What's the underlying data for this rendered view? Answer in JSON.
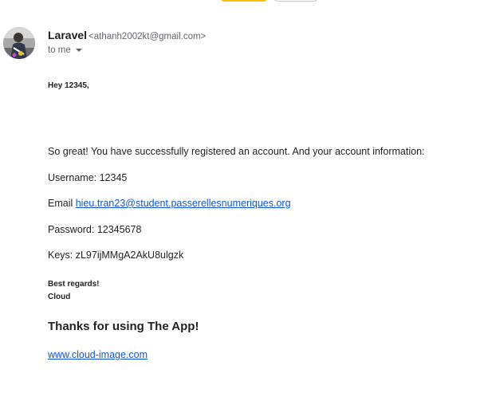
{
  "sender": {
    "name": "Laravel",
    "email": "<athanh2002kt@gmail.com>",
    "to_label": "to me"
  },
  "message": {
    "greeting": "Hey 12345,",
    "intro": "So great! You have successfully registered an account. And your account information:",
    "username_line": "Username: 12345",
    "email_label": "Email ",
    "email_value": "hieu.tran23@student.passerellesnumeriques.org",
    "password_line": "Password: 12345678",
    "keys_line": "Keys: zL97ijMMgA2AkU8ulgzk",
    "signoff": "Best regards!",
    "signature": "Cloud",
    "thanks": "Thanks for using The App!",
    "website_link": "www.cloud-image.com"
  },
  "colors": {
    "link": "#1155cc",
    "accent_chip": "#fbbc04"
  },
  "icons": {
    "avatar": "avatar-photo",
    "recipient_details": "caret-down-icon"
  }
}
